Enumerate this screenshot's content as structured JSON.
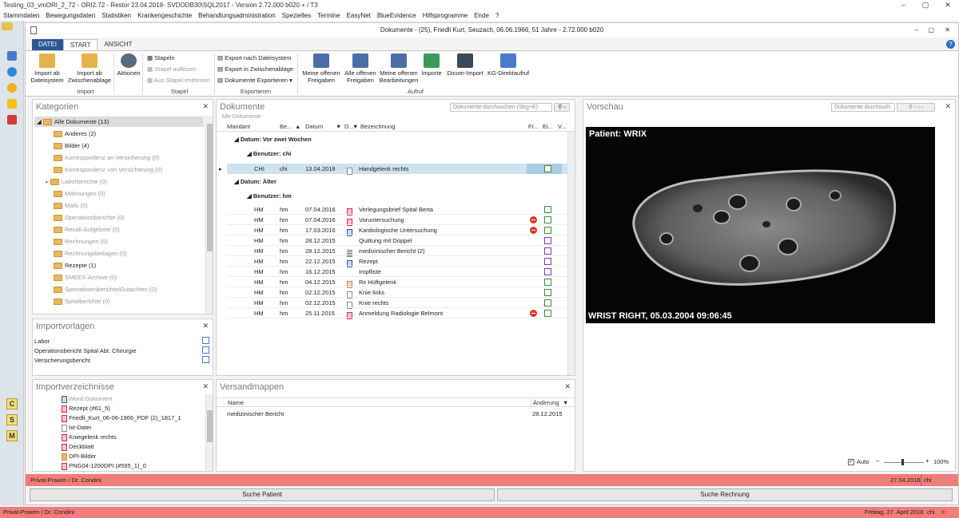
{
  "app": {
    "title": "Testing_03_vmORI_2_72 - ORI2.72 - Restor 23.04.2018- SVDODB30\\SQL2017 - Version 2.72.000 b020 + / T3",
    "menu": [
      "Stammdaten",
      "Bewegungsdaten",
      "Statistiken",
      "Krankengeschichte",
      "Behandlungsadministration",
      "Spezielles",
      "Termine",
      "EasyNet",
      "BlueEvidence",
      "Hilfsprogramme",
      "Ende",
      "?"
    ],
    "win_min": "–",
    "win_max": "▢",
    "win_close": "✕"
  },
  "doc": {
    "title": "Dokumente - (25), Friedli Kurt, Seuzach, 06.06.1966, 51 Jahre - 2.72.000 b020",
    "tabs": [
      "DATEI",
      "START",
      "ANSICHT"
    ],
    "help": "?"
  },
  "ribbon": {
    "import_ab_dateisystem": "Import ab Dateisystem",
    "import_ab_zwischenablage": "Import ab Zwischenablage",
    "aktionen": "Aktionen",
    "group_import": "Import",
    "stapeln": "Stapeln",
    "stapel_aufloesen": "Stapel auflösen",
    "aus_stapel_entfernen": "Aus Stapel entfernen",
    "group_stapel": "Stapel",
    "export_dateisystem": "Export nach Dateisystem",
    "export_zwischenablage": "Export in Zwischenablage",
    "dokumente_exportieren": "Dokumente Exportieren",
    "group_exportieren": "Exportieren",
    "meine_offenen_freigaben": "Meine offenen Freigaben",
    "alle_offenen_freigaben": "Alle offenen Freigaben",
    "meine_offenen_bearbeitungen": "Meine offenen Bearbeitungen",
    "importe": "Importe",
    "dicom_import": "Dicom-Import",
    "kg_direktaufruf": "KG-Direktaufruf",
    "group_aufruf": "Aufruf"
  },
  "kategorien": {
    "title": "Kategorien",
    "items": [
      {
        "label": "Alle Dokumente (13)",
        "active": true
      },
      {
        "label": "Anderes (2)",
        "active": true
      },
      {
        "label": "Bilder (4)",
        "active": true
      },
      {
        "label": "Korrespondenz an Versicherung (0)",
        "active": false
      },
      {
        "label": "Korrespondenz von Versicherung (0)",
        "active": false
      },
      {
        "label": "Laborberichte (0)",
        "active": false
      },
      {
        "label": "Mahnungen (0)",
        "active": false
      },
      {
        "label": "Mails (0)",
        "active": false
      },
      {
        "label": "Operationsberichte (0)",
        "active": false
      },
      {
        "label": "Recall-Aufgebote (0)",
        "active": false
      },
      {
        "label": "Rechnungen (0)",
        "active": false
      },
      {
        "label": "Rechnungsbeilagen (0)",
        "active": false
      },
      {
        "label": "Rezepte (1)",
        "active": true
      },
      {
        "label": "SMEEX-Archive (0)",
        "active": false
      },
      {
        "label": "Spezialistenberichte/Gutachten (0)",
        "active": false
      },
      {
        "label": "Spitalberichte (0)",
        "active": false
      }
    ]
  },
  "importvorlagen": {
    "title": "Importvorlagen",
    "items": [
      "Labor",
      "Operationsbericht Spital Abt. Chirurgie",
      "Versicherungsbericht"
    ]
  },
  "importverzeichnisse": {
    "title": "Importverzeichnisse",
    "items": [
      {
        "label": "Word-Dokument",
        "type": "word"
      },
      {
        "label": "Rezept (#61_5)",
        "type": "pdf"
      },
      {
        "label": "Friedli_Kurt_06-06-1966_PDF (2)_1817_1",
        "type": "pdf"
      },
      {
        "label": "txt-Datei",
        "type": "txt"
      },
      {
        "label": "Kniegelenk rechts",
        "type": "pdf"
      },
      {
        "label": "Deckblatt",
        "type": "pdf"
      },
      {
        "label": "DPI-Bilder",
        "type": "folder"
      },
      {
        "label": "PNG04-1200DPI (#595_1)_0",
        "type": "pdf"
      }
    ]
  },
  "dokumente": {
    "title": "Dokumente",
    "search_placeholder": "Dokumente durchsuchen (Strg+E)",
    "breadcrumb": "Alle Dokumente",
    "columns": [
      "Mandant",
      "Be...",
      "Datum",
      "D...",
      "Bezeichnung",
      "Fr...",
      "Ei...",
      "V..."
    ],
    "group1": "Datum: Vor zwei Wochen",
    "group1_user": "Benutzer: chi",
    "group2": "Datum: Älter",
    "group2_user": "Benutzer: hm",
    "selected_row": {
      "mandant": "CHI",
      "be": "chi",
      "datum": "13.04.2018",
      "bez": "Handgelenk rechts"
    },
    "rows": [
      {
        "mandant": "HM",
        "be": "hm",
        "datum": "07.04.2016",
        "bez": "Verlegungsbrief Spital Berta",
        "icon": "pdf",
        "stop": false,
        "ein": "green"
      },
      {
        "mandant": "HM",
        "be": "hm",
        "datum": "07.04.2016",
        "bez": "Voruntersuchung",
        "icon": "pdf",
        "stop": true,
        "ein": "green"
      },
      {
        "mandant": "HM",
        "be": "hm",
        "datum": "17.03.2016",
        "bez": "Kardiologische Untersuchung",
        "icon": "word",
        "stop": true,
        "ein": "green"
      },
      {
        "mandant": "HM",
        "be": "hm",
        "datum": "28.12.2015",
        "bez": "Quittung mit Doppel",
        "icon": "none",
        "stop": false,
        "ein": "purple"
      },
      {
        "mandant": "HM",
        "be": "hm",
        "datum": "28.12.2015",
        "bez": "medizinischer Bericht (2)",
        "icon": "lines",
        "stop": false,
        "ein": "purple"
      },
      {
        "mandant": "HM",
        "be": "hm",
        "datum": "22.12.2015",
        "bez": "Rezept",
        "icon": "word",
        "stop": false,
        "ein": "purple"
      },
      {
        "mandant": "HM",
        "be": "hm",
        "datum": "16.12.2015",
        "bez": "Impfliste",
        "icon": "none",
        "stop": false,
        "ein": "purple"
      },
      {
        "mandant": "HM",
        "be": "hm",
        "datum": "04.12.2015",
        "bez": "Rx Hüftgelenk",
        "icon": "img",
        "stop": false,
        "ein": "green"
      },
      {
        "mandant": "HM",
        "be": "hm",
        "datum": "02.12.2015",
        "bez": "Knie links",
        "icon": "doc",
        "stop": false,
        "ein": "green"
      },
      {
        "mandant": "HM",
        "be": "hm",
        "datum": "02.12.2015",
        "bez": "Knie rechts",
        "icon": "doc",
        "stop": false,
        "ein": "green"
      },
      {
        "mandant": "HM",
        "be": "hm",
        "datum": "25.11.2015",
        "bez": "Anmeldung Radiologie Belmont",
        "icon": "pdf",
        "stop": true,
        "ein": "green"
      }
    ]
  },
  "versandmappen": {
    "title": "Versandmappen",
    "col_name": "Name",
    "col_aenderung": "Änderung",
    "rows": [
      {
        "name": "medizinischer Bericht",
        "datum": "28.12.2015"
      }
    ]
  },
  "vorschau": {
    "title": "Vorschau",
    "search_placeholder": "Dokumente durchsuch",
    "patient_label": "Patient: WRIX",
    "image_caption": "WRIST RIGHT, 05.03.2004 09:06:45",
    "auto_label": "Auto",
    "zoom_label": "100%"
  },
  "statusbar": {
    "praxis": "Privat-Praxen / Dr. Condini",
    "date": "27.04.2018",
    "user": "chi"
  },
  "buttons": {
    "suche_patient": "Suche Patient",
    "suche_rechnung": "Suche Rechnung"
  },
  "bottombar": {
    "praxis": "Privat-Praxen / Dr. Condini",
    "date": "Freitag, 27. April 2018",
    "user": "chi"
  },
  "sidebar_letters": [
    "C",
    "S",
    "M"
  ]
}
